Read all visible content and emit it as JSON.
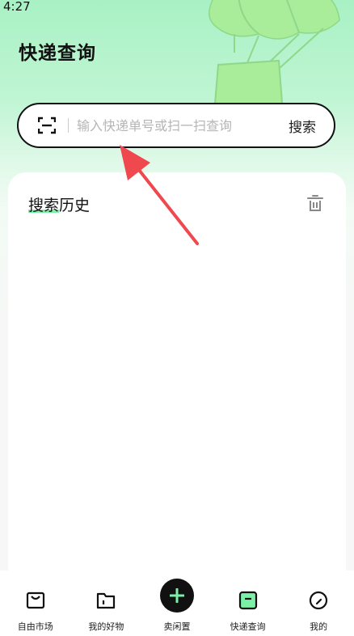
{
  "status_bar": {
    "time": "4:27"
  },
  "header": {
    "title": "快递查询"
  },
  "search": {
    "placeholder": "输入快递单号或扫一扫查询",
    "value": "",
    "button_label": "搜索"
  },
  "history": {
    "title_highlight": "搜索",
    "title_rest": "历史"
  },
  "tabs": [
    {
      "label": "自由市场",
      "icon": "market-bag-icon"
    },
    {
      "label": "我的好物",
      "icon": "folder-icon"
    },
    {
      "label": "卖闲置",
      "icon": "plus-icon"
    },
    {
      "label": "快递查询",
      "icon": "parcel-icon",
      "active": true
    },
    {
      "label": "我的",
      "icon": "profile-circle-icon"
    }
  ],
  "colors": {
    "accent": "#7cf0a6",
    "background_top": "#a8f1c4",
    "annotation_arrow": "#f0484f"
  }
}
